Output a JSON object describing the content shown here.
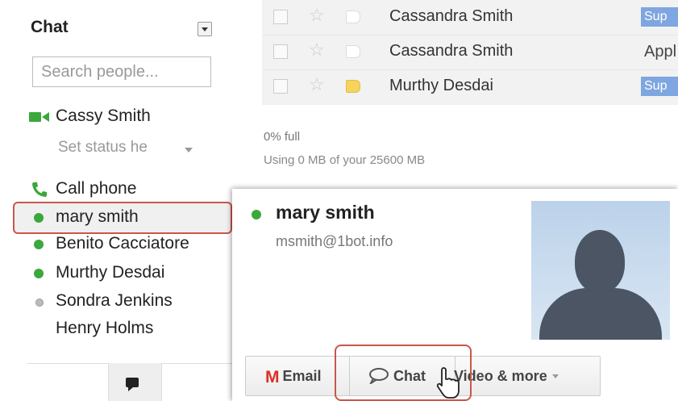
{
  "chat_panel": {
    "title": "Chat",
    "search_placeholder": "Search people...",
    "self_name": "Cassy Smith",
    "status_text": "Set status he",
    "call_phone": "Call phone",
    "contacts": [
      {
        "name": "mary smith",
        "status": "online"
      },
      {
        "name": "Benito Cacciatore",
        "status": "online"
      },
      {
        "name": "Murthy Desdai",
        "status": "online"
      },
      {
        "name": "Sondra Jenkins",
        "status": "idle"
      },
      {
        "name": "Henry Holms",
        "status": "none"
      }
    ]
  },
  "email_list": {
    "rows": [
      {
        "sender": "Cassandra Smith",
        "tag": "Sup",
        "labeled": false
      },
      {
        "sender": "Cassandra Smith",
        "tag": "Appl",
        "labeled": false
      },
      {
        "sender": "Murthy Desdai",
        "tag": "Sup",
        "labeled": true
      }
    ],
    "storage_percent": "0% full",
    "storage_detail": "Using 0 MB of your 25600 MB"
  },
  "contact_card": {
    "name": "mary smith",
    "email": "msmith@1bot.info",
    "buttons": {
      "email": "Email",
      "chat": "Chat",
      "video": "Video & more"
    }
  },
  "colors": {
    "online": "#3aa83a",
    "highlight": "#c9574a",
    "tag_blue": "#7ea6e0",
    "gmail_red": "#d93025"
  }
}
